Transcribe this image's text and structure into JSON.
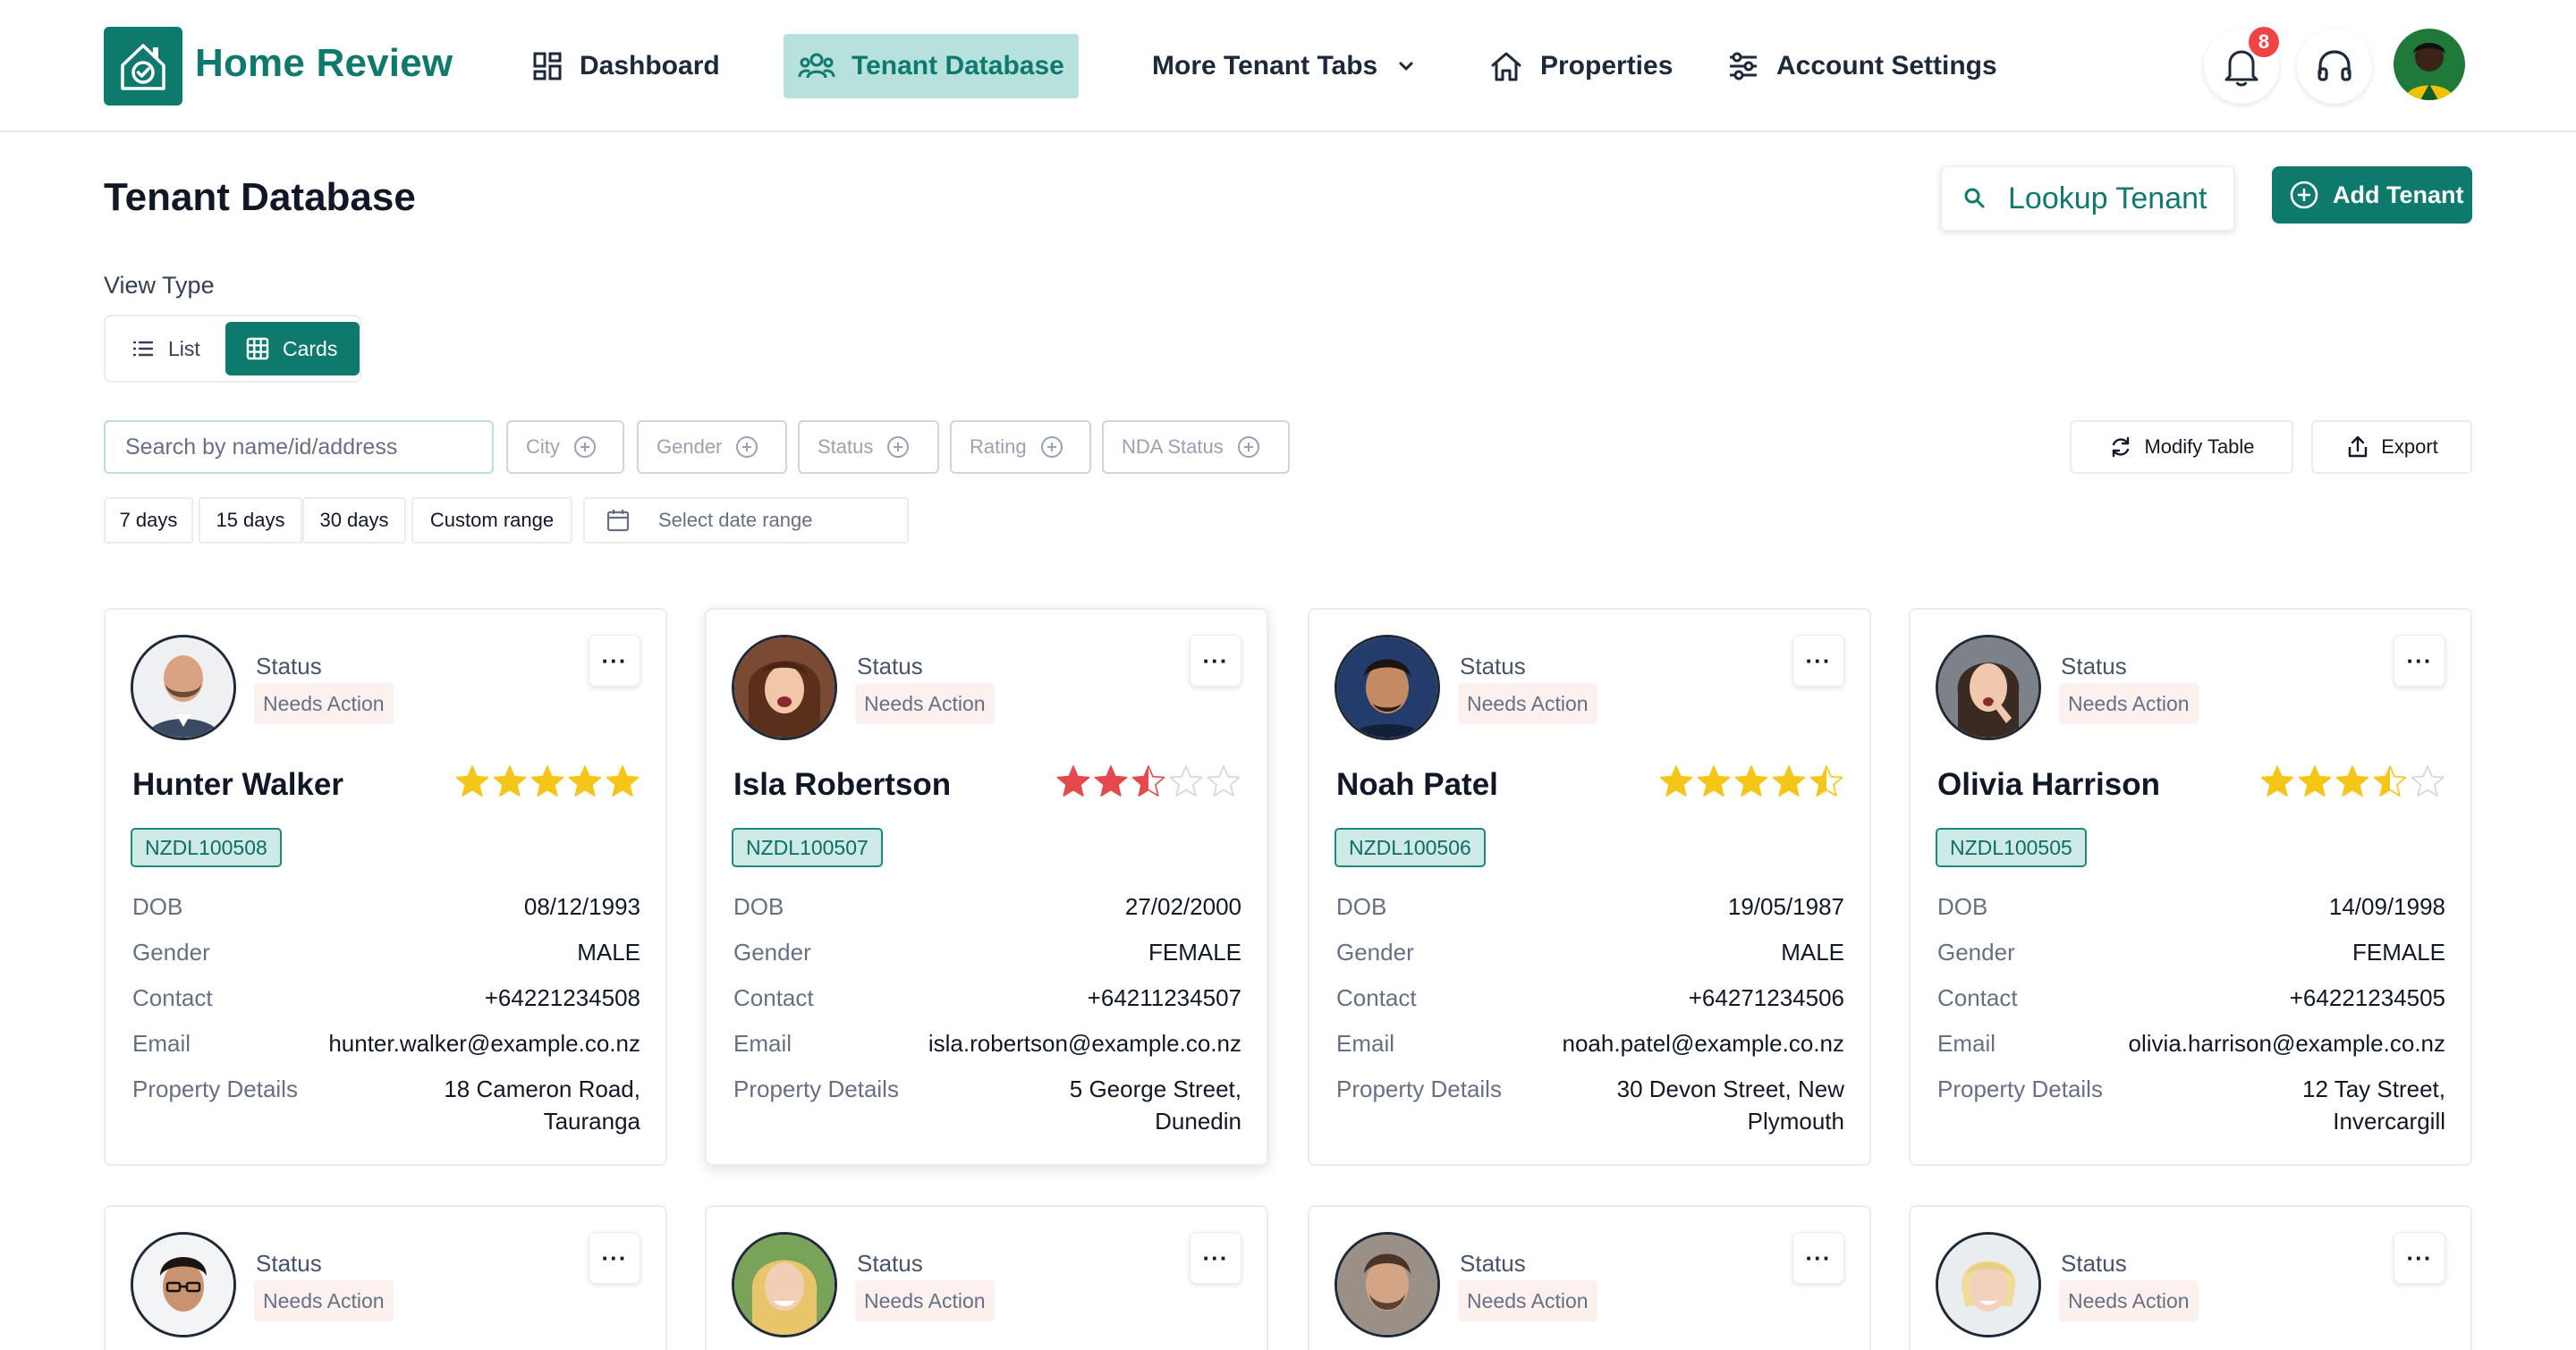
{
  "app": {
    "brand": "Home Review"
  },
  "nav": {
    "dashboard": "Dashboard",
    "tenant_database": "Tenant Database",
    "more_tabs": "More Tenant Tabs",
    "properties": "Properties",
    "account_settings": "Account Settings"
  },
  "header": {
    "notification_count": "8"
  },
  "page": {
    "title": "Tenant Database",
    "lookup_label": "Lookup Tenant",
    "add_label": "Add Tenant"
  },
  "view_type": {
    "label": "View Type",
    "list": "List",
    "cards": "Cards",
    "selected": "Cards"
  },
  "filters": {
    "search_placeholder": "Search by name/id/address",
    "chips": [
      "City",
      "Gender",
      "Status",
      "Rating",
      "NDA Status"
    ],
    "modify_table": "Modify Table",
    "export": "Export"
  },
  "date_ranges": {
    "options": [
      "7 days",
      "15 days",
      "30 days",
      "Custom range"
    ],
    "picker_placeholder": "Select date range"
  },
  "card_labels": {
    "status": "Status",
    "dob": "DOB",
    "gender": "Gender",
    "contact": "Contact",
    "email": "Email",
    "property": "Property Details",
    "more": "···"
  },
  "colors": {
    "accent": "#0e7a6e",
    "star_gold": "#f5c518",
    "star_red": "#e5484d",
    "star_empty": "#d0d5dd"
  },
  "tenants": [
    {
      "name": "Hunter Walker",
      "status": "Needs Action",
      "id": "NZDL100508",
      "rating": 5,
      "dob": "08/12/1993",
      "gender": "MALE",
      "contact": "+64221234508",
      "email": "hunter.walker@example.co.nz",
      "property": "18 Cameron Road, Tauranga"
    },
    {
      "name": "Isla Robertson",
      "status": "Needs Action",
      "id": "NZDL100507",
      "rating": 2.5,
      "dob": "27/02/2000",
      "gender": "FEMALE",
      "contact": "+64211234507",
      "email": "isla.robertson@example.co.nz",
      "property": "5 George Street, Dunedin"
    },
    {
      "name": "Noah Patel",
      "status": "Needs Action",
      "id": "NZDL100506",
      "rating": 4.5,
      "dob": "19/05/1987",
      "gender": "MALE",
      "contact": "+64271234506",
      "email": "noah.patel@example.co.nz",
      "property": "30 Devon Street, New Plymouth"
    },
    {
      "name": "Olivia Harrison",
      "status": "Needs Action",
      "id": "NZDL100505",
      "rating": 3.5,
      "dob": "14/09/1998",
      "gender": "FEMALE",
      "contact": "+64221234505",
      "email": "olivia.harrison@example.co.nz",
      "property": "12 Tay Street, Invercargill"
    },
    {
      "status": "Needs Action"
    },
    {
      "status": "Needs Action"
    },
    {
      "status": "Needs Action"
    },
    {
      "status": "Needs Action"
    }
  ]
}
